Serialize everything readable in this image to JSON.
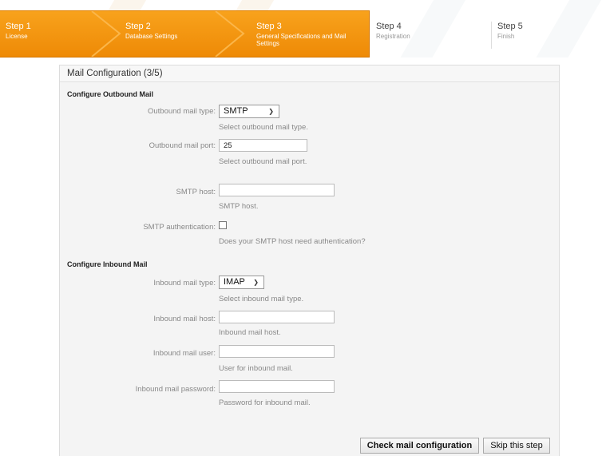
{
  "wizard": {
    "steps": [
      {
        "title": "Step 1",
        "subtitle": "License"
      },
      {
        "title": "Step 2",
        "subtitle": "Database Settings"
      },
      {
        "title": "Step 3",
        "subtitle": "General Specifications and Mail Settings"
      },
      {
        "title": "Step 4",
        "subtitle": "Registration"
      },
      {
        "title": "Step 5",
        "subtitle": "Finish"
      }
    ]
  },
  "panel": {
    "title": "Mail Configuration (3/5)",
    "outbound": {
      "heading": "Configure Outbound Mail",
      "type_label": "Outbound mail type:",
      "type_value": "SMTP",
      "type_hint": "Select outbound mail type.",
      "port_label": "Outbound mail port:",
      "port_value": "25",
      "port_hint": "Select outbound mail port.",
      "host_label": "SMTP host:",
      "host_value": "",
      "host_hint": "SMTP host.",
      "auth_label": "SMTP authentication:",
      "auth_hint": "Does your SMTP host need authentication?"
    },
    "inbound": {
      "heading": "Configure Inbound Mail",
      "type_label": "Inbound mail type:",
      "type_value": "IMAP",
      "type_hint": "Select inbound mail type.",
      "host_label": "Inbound mail host:",
      "host_value": "",
      "host_hint": "Inbound mail host.",
      "user_label": "Inbound mail user:",
      "user_value": "",
      "user_hint": "User for inbound mail.",
      "password_label": "Inbound mail password:",
      "password_value": "",
      "password_hint": "Password for inbound mail."
    },
    "buttons": {
      "check": "Check mail configuration",
      "skip": "Skip this step"
    }
  },
  "colors": {
    "active_step": "#f39a12",
    "inactive_step": "#ffffff"
  }
}
